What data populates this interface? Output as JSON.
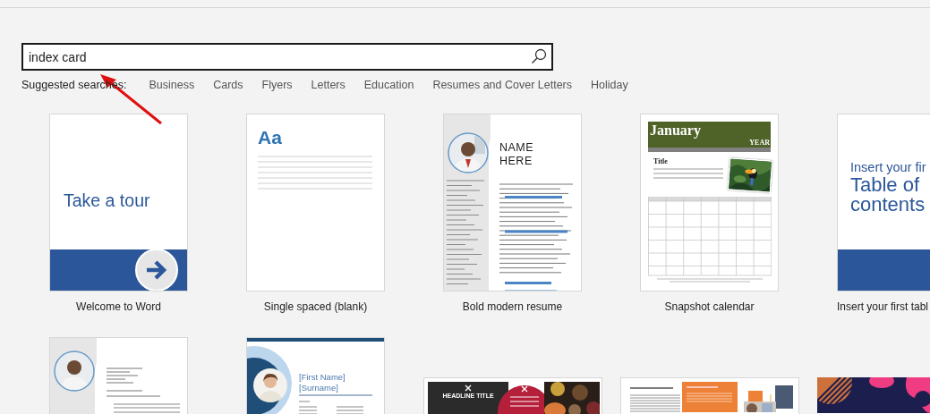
{
  "search": {
    "value": "index card"
  },
  "suggested_label": "Suggested searches:",
  "suggestions": [
    "Business",
    "Cards",
    "Flyers",
    "Letters",
    "Education",
    "Resumes and Cover Letters",
    "Holiday"
  ],
  "templates": [
    {
      "kind": "tour",
      "label": "Welcome to Word",
      "texts": [
        "Take a tour"
      ]
    },
    {
      "kind": "blank",
      "label": "Single spaced (blank)",
      "texts": [
        "Aa"
      ]
    },
    {
      "kind": "resume",
      "label": "Bold modern resume",
      "texts": [
        "NAME HERE"
      ]
    },
    {
      "kind": "calendar",
      "label": "Snapshot calendar",
      "texts": [
        "January",
        "YEAR",
        "Title"
      ]
    },
    {
      "kind": "toc",
      "label": "Insert your first tabl",
      "texts": [
        "Insert your fir",
        "Table of contents"
      ]
    }
  ],
  "more_templates": [
    {
      "kind": "letter"
    },
    {
      "kind": "blue-resume",
      "texts": [
        "[First Name]",
        "[Surname]"
      ]
    },
    {
      "kind": "flyer",
      "texts": [
        "HEADLINE TITLE"
      ]
    },
    {
      "kind": "report"
    },
    {
      "kind": "abstract"
    }
  ]
}
